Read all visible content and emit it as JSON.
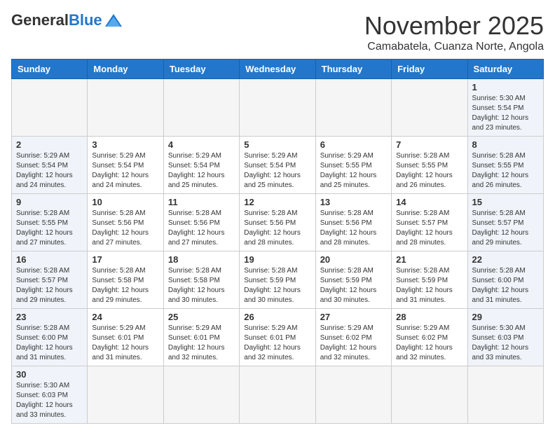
{
  "header": {
    "logo_general": "General",
    "logo_blue": "Blue",
    "month_title": "November 2025",
    "subtitle": "Camabatela, Cuanza Norte, Angola"
  },
  "weekdays": [
    "Sunday",
    "Monday",
    "Tuesday",
    "Wednesday",
    "Thursday",
    "Friday",
    "Saturday"
  ],
  "days": {
    "d1": {
      "num": "1",
      "sunrise": "5:30 AM",
      "sunset": "5:54 PM",
      "daylight": "12 hours and 23 minutes."
    },
    "d2": {
      "num": "2",
      "sunrise": "5:29 AM",
      "sunset": "5:54 PM",
      "daylight": "12 hours and 24 minutes."
    },
    "d3": {
      "num": "3",
      "sunrise": "5:29 AM",
      "sunset": "5:54 PM",
      "daylight": "12 hours and 24 minutes."
    },
    "d4": {
      "num": "4",
      "sunrise": "5:29 AM",
      "sunset": "5:54 PM",
      "daylight": "12 hours and 25 minutes."
    },
    "d5": {
      "num": "5",
      "sunrise": "5:29 AM",
      "sunset": "5:54 PM",
      "daylight": "12 hours and 25 minutes."
    },
    "d6": {
      "num": "6",
      "sunrise": "5:29 AM",
      "sunset": "5:55 PM",
      "daylight": "12 hours and 25 minutes."
    },
    "d7": {
      "num": "7",
      "sunrise": "5:28 AM",
      "sunset": "5:55 PM",
      "daylight": "12 hours and 26 minutes."
    },
    "d8": {
      "num": "8",
      "sunrise": "5:28 AM",
      "sunset": "5:55 PM",
      "daylight": "12 hours and 26 minutes."
    },
    "d9": {
      "num": "9",
      "sunrise": "5:28 AM",
      "sunset": "5:55 PM",
      "daylight": "12 hours and 27 minutes."
    },
    "d10": {
      "num": "10",
      "sunrise": "5:28 AM",
      "sunset": "5:56 PM",
      "daylight": "12 hours and 27 minutes."
    },
    "d11": {
      "num": "11",
      "sunrise": "5:28 AM",
      "sunset": "5:56 PM",
      "daylight": "12 hours and 27 minutes."
    },
    "d12": {
      "num": "12",
      "sunrise": "5:28 AM",
      "sunset": "5:56 PM",
      "daylight": "12 hours and 28 minutes."
    },
    "d13": {
      "num": "13",
      "sunrise": "5:28 AM",
      "sunset": "5:56 PM",
      "daylight": "12 hours and 28 minutes."
    },
    "d14": {
      "num": "14",
      "sunrise": "5:28 AM",
      "sunset": "5:57 PM",
      "daylight": "12 hours and 28 minutes."
    },
    "d15": {
      "num": "15",
      "sunrise": "5:28 AM",
      "sunset": "5:57 PM",
      "daylight": "12 hours and 29 minutes."
    },
    "d16": {
      "num": "16",
      "sunrise": "5:28 AM",
      "sunset": "5:57 PM",
      "daylight": "12 hours and 29 minutes."
    },
    "d17": {
      "num": "17",
      "sunrise": "5:28 AM",
      "sunset": "5:58 PM",
      "daylight": "12 hours and 29 minutes."
    },
    "d18": {
      "num": "18",
      "sunrise": "5:28 AM",
      "sunset": "5:58 PM",
      "daylight": "12 hours and 30 minutes."
    },
    "d19": {
      "num": "19",
      "sunrise": "5:28 AM",
      "sunset": "5:59 PM",
      "daylight": "12 hours and 30 minutes."
    },
    "d20": {
      "num": "20",
      "sunrise": "5:28 AM",
      "sunset": "5:59 PM",
      "daylight": "12 hours and 30 minutes."
    },
    "d21": {
      "num": "21",
      "sunrise": "5:28 AM",
      "sunset": "5:59 PM",
      "daylight": "12 hours and 31 minutes."
    },
    "d22": {
      "num": "22",
      "sunrise": "5:28 AM",
      "sunset": "6:00 PM",
      "daylight": "12 hours and 31 minutes."
    },
    "d23": {
      "num": "23",
      "sunrise": "5:28 AM",
      "sunset": "6:00 PM",
      "daylight": "12 hours and 31 minutes."
    },
    "d24": {
      "num": "24",
      "sunrise": "5:29 AM",
      "sunset": "6:01 PM",
      "daylight": "12 hours and 31 minutes."
    },
    "d25": {
      "num": "25",
      "sunrise": "5:29 AM",
      "sunset": "6:01 PM",
      "daylight": "12 hours and 32 minutes."
    },
    "d26": {
      "num": "26",
      "sunrise": "5:29 AM",
      "sunset": "6:01 PM",
      "daylight": "12 hours and 32 minutes."
    },
    "d27": {
      "num": "27",
      "sunrise": "5:29 AM",
      "sunset": "6:02 PM",
      "daylight": "12 hours and 32 minutes."
    },
    "d28": {
      "num": "28",
      "sunrise": "5:29 AM",
      "sunset": "6:02 PM",
      "daylight": "12 hours and 32 minutes."
    },
    "d29": {
      "num": "29",
      "sunrise": "5:30 AM",
      "sunset": "6:03 PM",
      "daylight": "12 hours and 33 minutes."
    },
    "d30": {
      "num": "30",
      "sunrise": "5:30 AM",
      "sunset": "6:03 PM",
      "daylight": "12 hours and 33 minutes."
    }
  },
  "labels": {
    "sunrise": "Sunrise:",
    "sunset": "Sunset:",
    "daylight": "Daylight:"
  }
}
